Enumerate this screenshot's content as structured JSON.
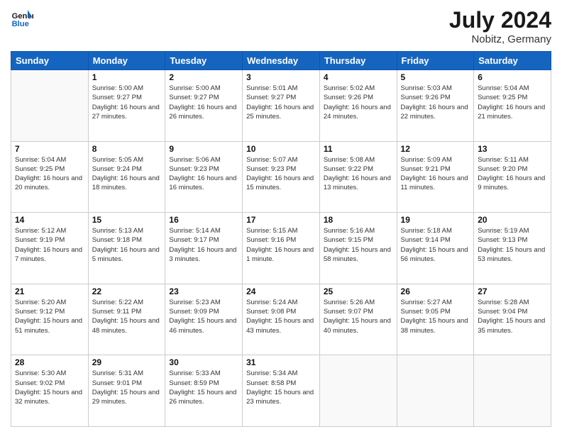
{
  "header": {
    "logo_line1": "General",
    "logo_line2": "Blue",
    "month": "July 2024",
    "location": "Nobitz, Germany"
  },
  "weekdays": [
    "Sunday",
    "Monday",
    "Tuesday",
    "Wednesday",
    "Thursday",
    "Friday",
    "Saturday"
  ],
  "weeks": [
    [
      {
        "day": "",
        "sunrise": "",
        "sunset": "",
        "daylight": ""
      },
      {
        "day": "1",
        "sunrise": "Sunrise: 5:00 AM",
        "sunset": "Sunset: 9:27 PM",
        "daylight": "Daylight: 16 hours and 27 minutes."
      },
      {
        "day": "2",
        "sunrise": "Sunrise: 5:00 AM",
        "sunset": "Sunset: 9:27 PM",
        "daylight": "Daylight: 16 hours and 26 minutes."
      },
      {
        "day": "3",
        "sunrise": "Sunrise: 5:01 AM",
        "sunset": "Sunset: 9:27 PM",
        "daylight": "Daylight: 16 hours and 25 minutes."
      },
      {
        "day": "4",
        "sunrise": "Sunrise: 5:02 AM",
        "sunset": "Sunset: 9:26 PM",
        "daylight": "Daylight: 16 hours and 24 minutes."
      },
      {
        "day": "5",
        "sunrise": "Sunrise: 5:03 AM",
        "sunset": "Sunset: 9:26 PM",
        "daylight": "Daylight: 16 hours and 22 minutes."
      },
      {
        "day": "6",
        "sunrise": "Sunrise: 5:04 AM",
        "sunset": "Sunset: 9:25 PM",
        "daylight": "Daylight: 16 hours and 21 minutes."
      }
    ],
    [
      {
        "day": "7",
        "sunrise": "Sunrise: 5:04 AM",
        "sunset": "Sunset: 9:25 PM",
        "daylight": "Daylight: 16 hours and 20 minutes."
      },
      {
        "day": "8",
        "sunrise": "Sunrise: 5:05 AM",
        "sunset": "Sunset: 9:24 PM",
        "daylight": "Daylight: 16 hours and 18 minutes."
      },
      {
        "day": "9",
        "sunrise": "Sunrise: 5:06 AM",
        "sunset": "Sunset: 9:23 PM",
        "daylight": "Daylight: 16 hours and 16 minutes."
      },
      {
        "day": "10",
        "sunrise": "Sunrise: 5:07 AM",
        "sunset": "Sunset: 9:23 PM",
        "daylight": "Daylight: 16 hours and 15 minutes."
      },
      {
        "day": "11",
        "sunrise": "Sunrise: 5:08 AM",
        "sunset": "Sunset: 9:22 PM",
        "daylight": "Daylight: 16 hours and 13 minutes."
      },
      {
        "day": "12",
        "sunrise": "Sunrise: 5:09 AM",
        "sunset": "Sunset: 9:21 PM",
        "daylight": "Daylight: 16 hours and 11 minutes."
      },
      {
        "day": "13",
        "sunrise": "Sunrise: 5:11 AM",
        "sunset": "Sunset: 9:20 PM",
        "daylight": "Daylight: 16 hours and 9 minutes."
      }
    ],
    [
      {
        "day": "14",
        "sunrise": "Sunrise: 5:12 AM",
        "sunset": "Sunset: 9:19 PM",
        "daylight": "Daylight: 16 hours and 7 minutes."
      },
      {
        "day": "15",
        "sunrise": "Sunrise: 5:13 AM",
        "sunset": "Sunset: 9:18 PM",
        "daylight": "Daylight: 16 hours and 5 minutes."
      },
      {
        "day": "16",
        "sunrise": "Sunrise: 5:14 AM",
        "sunset": "Sunset: 9:17 PM",
        "daylight": "Daylight: 16 hours and 3 minutes."
      },
      {
        "day": "17",
        "sunrise": "Sunrise: 5:15 AM",
        "sunset": "Sunset: 9:16 PM",
        "daylight": "Daylight: 16 hours and 1 minute."
      },
      {
        "day": "18",
        "sunrise": "Sunrise: 5:16 AM",
        "sunset": "Sunset: 9:15 PM",
        "daylight": "Daylight: 15 hours and 58 minutes."
      },
      {
        "day": "19",
        "sunrise": "Sunrise: 5:18 AM",
        "sunset": "Sunset: 9:14 PM",
        "daylight": "Daylight: 15 hours and 56 minutes."
      },
      {
        "day": "20",
        "sunrise": "Sunrise: 5:19 AM",
        "sunset": "Sunset: 9:13 PM",
        "daylight": "Daylight: 15 hours and 53 minutes."
      }
    ],
    [
      {
        "day": "21",
        "sunrise": "Sunrise: 5:20 AM",
        "sunset": "Sunset: 9:12 PM",
        "daylight": "Daylight: 15 hours and 51 minutes."
      },
      {
        "day": "22",
        "sunrise": "Sunrise: 5:22 AM",
        "sunset": "Sunset: 9:11 PM",
        "daylight": "Daylight: 15 hours and 48 minutes."
      },
      {
        "day": "23",
        "sunrise": "Sunrise: 5:23 AM",
        "sunset": "Sunset: 9:09 PM",
        "daylight": "Daylight: 15 hours and 46 minutes."
      },
      {
        "day": "24",
        "sunrise": "Sunrise: 5:24 AM",
        "sunset": "Sunset: 9:08 PM",
        "daylight": "Daylight: 15 hours and 43 minutes."
      },
      {
        "day": "25",
        "sunrise": "Sunrise: 5:26 AM",
        "sunset": "Sunset: 9:07 PM",
        "daylight": "Daylight: 15 hours and 40 minutes."
      },
      {
        "day": "26",
        "sunrise": "Sunrise: 5:27 AM",
        "sunset": "Sunset: 9:05 PM",
        "daylight": "Daylight: 15 hours and 38 minutes."
      },
      {
        "day": "27",
        "sunrise": "Sunrise: 5:28 AM",
        "sunset": "Sunset: 9:04 PM",
        "daylight": "Daylight: 15 hours and 35 minutes."
      }
    ],
    [
      {
        "day": "28",
        "sunrise": "Sunrise: 5:30 AM",
        "sunset": "Sunset: 9:02 PM",
        "daylight": "Daylight: 15 hours and 32 minutes."
      },
      {
        "day": "29",
        "sunrise": "Sunrise: 5:31 AM",
        "sunset": "Sunset: 9:01 PM",
        "daylight": "Daylight: 15 hours and 29 minutes."
      },
      {
        "day": "30",
        "sunrise": "Sunrise: 5:33 AM",
        "sunset": "Sunset: 8:59 PM",
        "daylight": "Daylight: 15 hours and 26 minutes."
      },
      {
        "day": "31",
        "sunrise": "Sunrise: 5:34 AM",
        "sunset": "Sunset: 8:58 PM",
        "daylight": "Daylight: 15 hours and 23 minutes."
      },
      {
        "day": "",
        "sunrise": "",
        "sunset": "",
        "daylight": ""
      },
      {
        "day": "",
        "sunrise": "",
        "sunset": "",
        "daylight": ""
      },
      {
        "day": "",
        "sunrise": "",
        "sunset": "",
        "daylight": ""
      }
    ]
  ]
}
